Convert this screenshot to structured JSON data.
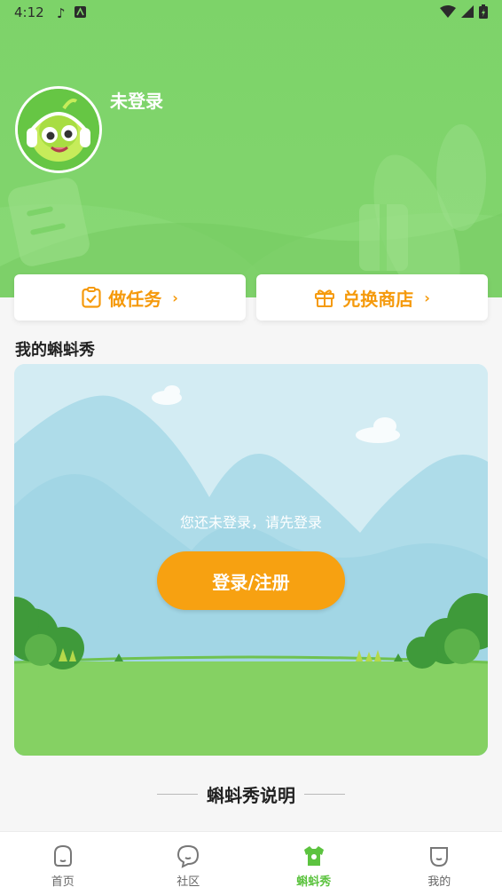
{
  "status_bar": {
    "time": "4:12"
  },
  "profile": {
    "username": "未登录"
  },
  "quick_actions": {
    "task_label": "做任务",
    "shop_label": "兑换商店",
    "chevron": "›"
  },
  "section": {
    "title": "我的蝌蚪秀"
  },
  "show_card": {
    "hint": "您还未登录，请先登录",
    "button_label": "登录/注册"
  },
  "explain": {
    "title": "蝌蚪秀说明"
  },
  "tabbar": {
    "items": [
      {
        "label": "首页",
        "icon": "home-icon"
      },
      {
        "label": "社区",
        "icon": "community-icon"
      },
      {
        "label": "蝌蚪秀",
        "icon": "tadpole-show-icon",
        "active": true
      },
      {
        "label": "我的",
        "icon": "profile-icon"
      }
    ]
  },
  "colors": {
    "header_green": "#7dd369",
    "accent_orange": "#f7a111",
    "active_tab_green": "#5cc33f"
  }
}
